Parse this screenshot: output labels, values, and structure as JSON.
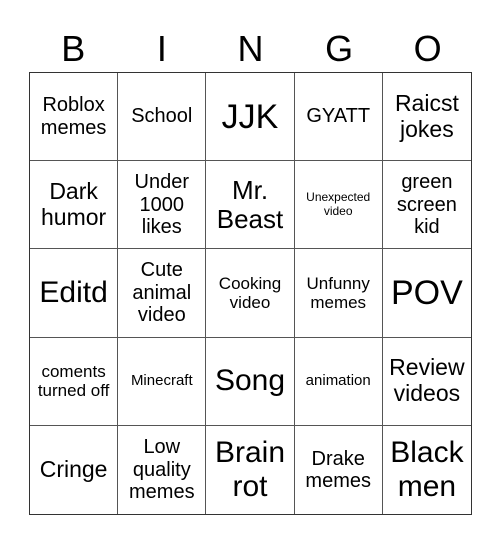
{
  "card": {
    "header": [
      "B",
      "I",
      "N",
      "G",
      "O"
    ],
    "cells": [
      [
        "Roblox memes",
        "School",
        "JJK",
        "GYATT",
        "Raicst jokes"
      ],
      [
        "Dark humor",
        "Under 1000 likes",
        "Mr. Beast",
        "Unexpected video",
        "green screen kid"
      ],
      [
        "Editd",
        "Cute animal video",
        "Cooking video",
        "Unfunny memes",
        "POV"
      ],
      [
        "coments turned off",
        "Minecraft",
        "Song",
        "animation",
        "Review videos"
      ],
      [
        "Cringe",
        "Low quality memes",
        "Brain rot",
        "Drake memes",
        "Black men"
      ]
    ],
    "colors": {
      "background": "#ffffff",
      "text": "#000000",
      "grid_line": "#555555"
    }
  }
}
